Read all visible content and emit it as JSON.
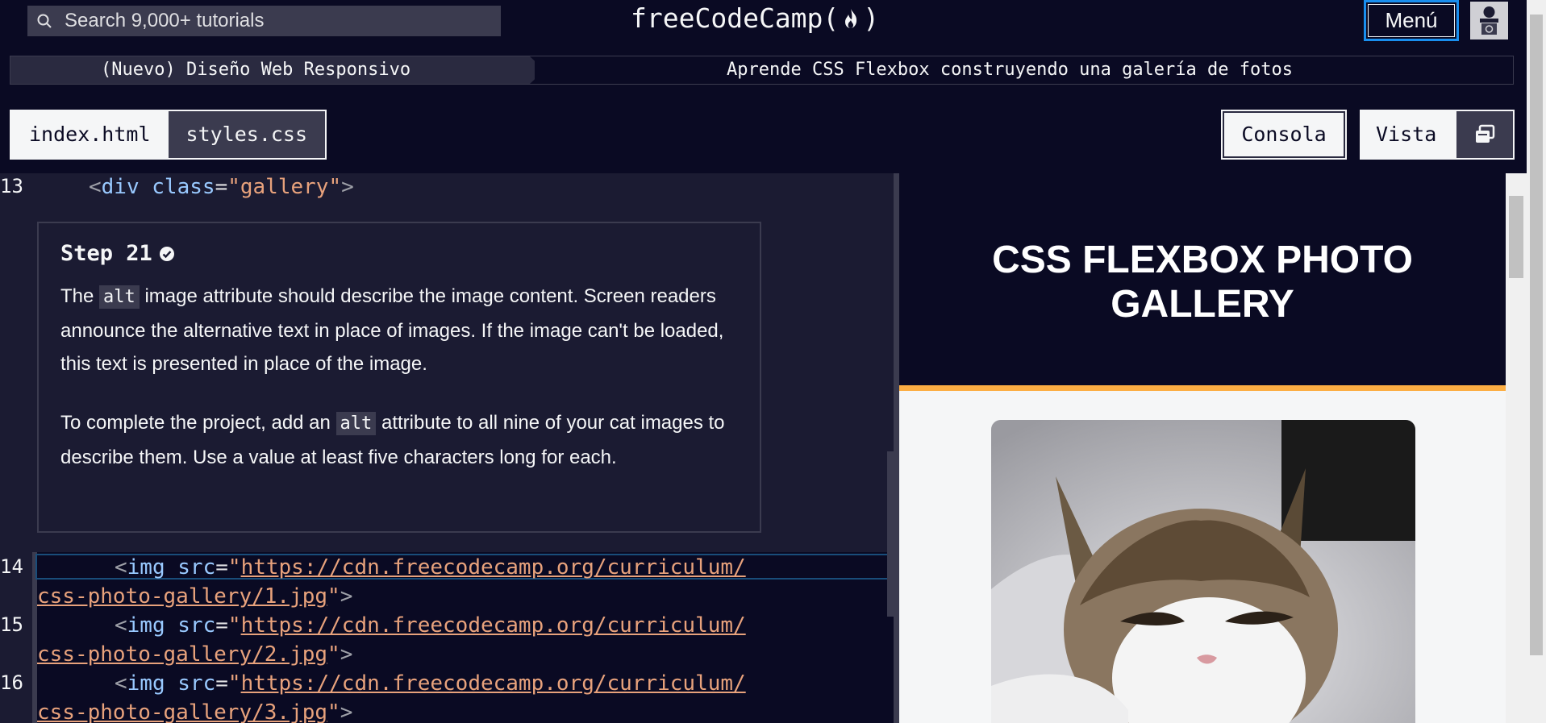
{
  "nav": {
    "search_placeholder": "Search 9,000+ tutorials",
    "logo_text": "freeCodeCamp(",
    "logo_close": ")",
    "menu_label": "Menú"
  },
  "breadcrumb": {
    "course": "(Nuevo) Diseño Web Responsivo",
    "project": "Aprende CSS Flexbox construyendo una galería de fotos"
  },
  "tabs": [
    {
      "label": "index.html",
      "active": true
    },
    {
      "label": "styles.css",
      "active": false
    }
  ],
  "toolbar": {
    "console_label": "Consola",
    "preview_label": "Vista"
  },
  "editor": {
    "lines": [
      {
        "num": "13",
        "indent": "  ",
        "tag": "div",
        "attr": "class",
        "value": "gallery"
      },
      {
        "num": "14",
        "indent": "    ",
        "tag": "img",
        "attr": "src",
        "value_a": "https://cdn.freecodecamp.org/curriculum/",
        "value_b": "css-photo-gallery/1.jpg"
      },
      {
        "num": "15",
        "indent": "    ",
        "tag": "img",
        "attr": "src",
        "value_a": "https://cdn.freecodecamp.org/curriculum/",
        "value_b": "css-photo-gallery/2.jpg"
      },
      {
        "num": "16",
        "indent": "    ",
        "tag": "img",
        "attr": "src",
        "value_a": "https://cdn.freecodecamp.org/curriculum/",
        "value_b": "css-photo-gallery/3.jpg"
      }
    ]
  },
  "step": {
    "title": "Step 21",
    "p1_a": "The ",
    "p1_code": "alt",
    "p1_b": " image attribute should describe the image content. Screen readers announce the alternative text in place of images. If the image can't be loaded, this text is presented in place of the image.",
    "p2_a": "To complete the project, add an ",
    "p2_code": "alt",
    "p2_b": " attribute to all nine of your cat images to describe them. Use a value at least five characters long for each."
  },
  "preview": {
    "title": "CSS FLEXBOX PHOTO GALLERY",
    "header_bg": "#0a0a23",
    "accent_border": "#fcae44"
  },
  "colors": {
    "nav_bg": "#0a0a23",
    "editor_bg": "#1b1b32",
    "focus_blue": "#198eee"
  }
}
